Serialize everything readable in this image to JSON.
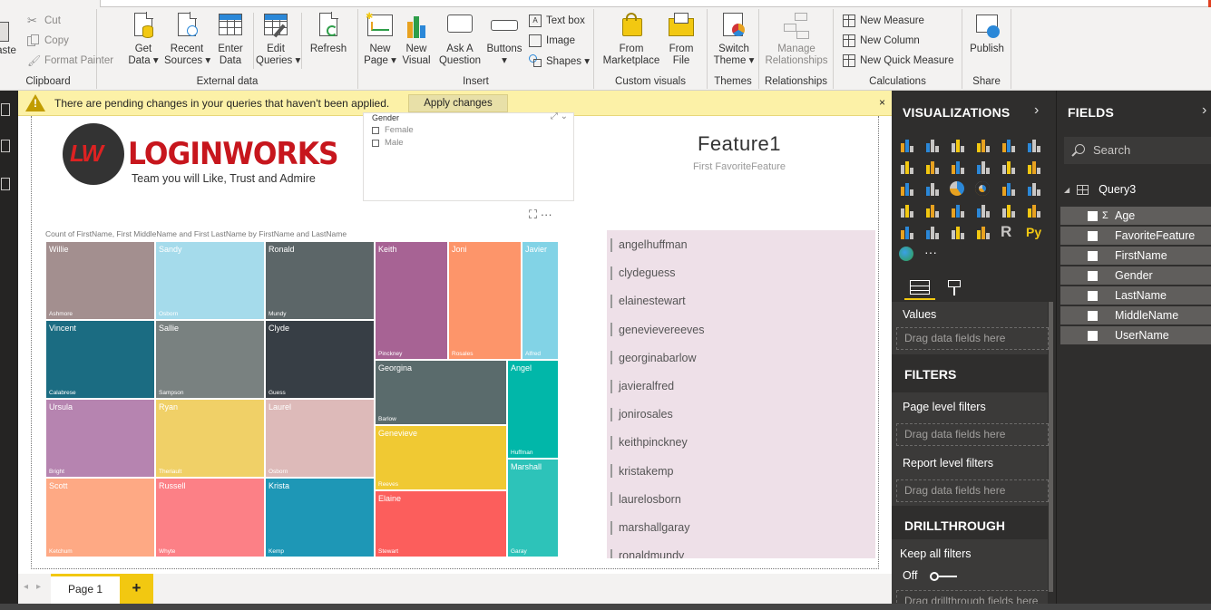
{
  "ribbon": {
    "clipboard": {
      "paste_label": "aste",
      "cut_label": "Cut",
      "copy_label": "Copy",
      "format_painter_label": "Format Painter",
      "group_label": "Clipboard"
    },
    "external_data": {
      "get_data_label": "Get\nData ▾",
      "recent_sources_label": "Recent\nSources ▾",
      "enter_data_label": "Enter\nData",
      "edit_queries_label": "Edit\nQueries ▾",
      "refresh_label": "Refresh",
      "group_label": "External data"
    },
    "insert": {
      "new_page_label": "New\nPage ▾",
      "new_visual_label": "New\nVisual",
      "ask_question_label": "Ask A\nQuestion",
      "buttons_label": "Buttons\n▾",
      "text_box_label": "Text box",
      "image_label": "Image",
      "shapes_label": "Shapes ▾",
      "group_label": "Insert"
    },
    "custom_visuals": {
      "from_marketplace_label": "From\nMarketplace",
      "from_file_label": "From\nFile",
      "group_label": "Custom visuals"
    },
    "themes": {
      "switch_theme_label": "Switch\nTheme ▾",
      "group_label": "Themes"
    },
    "relationships": {
      "manage_relationships_label": "Manage\nRelationships",
      "group_label": "Relationships"
    },
    "calculations": {
      "new_measure_label": "New Measure",
      "new_column_label": "New Column",
      "new_quick_measure_label": "New Quick Measure",
      "group_label": "Calculations"
    },
    "share": {
      "publish_label": "Publish",
      "group_label": "Share"
    }
  },
  "banner": {
    "message": "There are pending changes in your queries that haven't been applied.",
    "apply_label": "Apply changes",
    "close_label": "×"
  },
  "report": {
    "logo": {
      "mark": "LW",
      "name": "LOGINWORKS",
      "tagline": "Team you will Like, Trust and Admire"
    },
    "slicer": {
      "title": "Gender",
      "options": [
        "Female",
        "Male"
      ],
      "icons": "⤢ ⌄"
    },
    "visual_icons": "⛶  ···",
    "card": {
      "value": "Feature1",
      "label": "First FavoriteFeature"
    },
    "treemap_title": "Count of FirstName, First MiddleName and First LastName by FirstName and LastName",
    "list_items": [
      "angelhuffman",
      "clydeguess",
      "elainestewart",
      "genevievereeves",
      "georginabarlow",
      "javieralfred",
      "jonirosales",
      "keithpinckney",
      "kristakemp",
      "laurelosborn",
      "marshallgaray",
      "ronaldmundy"
    ]
  },
  "chart_data": {
    "type": "treemap",
    "title": "Count of FirstName, First MiddleName and First LastName by FirstName and LastName",
    "items": [
      {
        "first": "Willie",
        "last": "Ashmore",
        "color": "#a38f8f"
      },
      {
        "first": "Sandy",
        "last": "Osborn",
        "color": "#a5dbeb"
      },
      {
        "first": "Ronald",
        "last": "Mundy",
        "color": "#5c6668"
      },
      {
        "first": "Vincent",
        "last": "Calabrese",
        "color": "#1b6c82"
      },
      {
        "first": "Sallie",
        "last": "Sampson",
        "color": "#798180"
      },
      {
        "first": "Clyde",
        "last": "Guess",
        "color": "#373e45"
      },
      {
        "first": "Ursula",
        "last": "Bright",
        "color": "#b684b0"
      },
      {
        "first": "Ryan",
        "last": "Theriault",
        "color": "#f0d067"
      },
      {
        "first": "Laurel",
        "last": "Osborn",
        "color": "#ddbab9"
      },
      {
        "first": "Scott",
        "last": "Ketchum",
        "color": "#fea984"
      },
      {
        "first": "Russell",
        "last": "Whyte",
        "color": "#fc8086"
      },
      {
        "first": "Krista",
        "last": "Kemp",
        "color": "#1e97b6"
      },
      {
        "first": "Keith",
        "last": "Pinckney",
        "color": "#a76394"
      },
      {
        "first": "Joni",
        "last": "Rosales",
        "color": "#fd956a"
      },
      {
        "first": "Javier",
        "last": "Alfred",
        "color": "#82d3e6"
      },
      {
        "first": "Georgina",
        "last": "Barlow",
        "color": "#5a6b6c"
      },
      {
        "first": "Angel",
        "last": "Huffman",
        "color": "#01b7a9"
      },
      {
        "first": "Genevieve",
        "last": "Reeves",
        "color": "#f0c933"
      },
      {
        "first": "Marshall",
        "last": "Garay",
        "color": "#2dc3b9"
      },
      {
        "first": "Elaine",
        "last": "Stewart",
        "color": "#fc5e5c"
      }
    ]
  },
  "page_tabs": {
    "page1_label": "Page 1",
    "add_label": "+",
    "prev": "◂",
    "next": "▸"
  },
  "visualizations": {
    "title": "VISUALIZATIONS",
    "values_label": "Values",
    "values_drop": "Drag data fields here",
    "filters_title": "FILTERS",
    "page_filters_label": "Page level filters",
    "page_filters_drop": "Drag data fields here",
    "report_filters_label": "Report level filters",
    "report_filters_drop": "Drag data fields here",
    "drillthrough_title": "DRILLTHROUGH",
    "keep_all_filters_label": "Keep all filters",
    "toggle_state": "Off",
    "drill_drop": "Drag drillthrough fields here",
    "more_label": "···",
    "r_label": "R",
    "py_label": "Py"
  },
  "fields": {
    "title": "FIELDS",
    "search_placeholder": "Search",
    "table_name": "Query3",
    "items": [
      {
        "name": "Age",
        "sigma": "Σ"
      },
      {
        "name": "FavoriteFeature",
        "sigma": ""
      },
      {
        "name": "FirstName",
        "sigma": ""
      },
      {
        "name": "Gender",
        "sigma": ""
      },
      {
        "name": "LastName",
        "sigma": ""
      },
      {
        "name": "MiddleName",
        "sigma": ""
      },
      {
        "name": "UserName",
        "sigma": ""
      }
    ]
  },
  "colors": {
    "accent": "#f2c811",
    "pane_bg": "#2f2e2d",
    "banner_bg": "#fcf1a7"
  }
}
